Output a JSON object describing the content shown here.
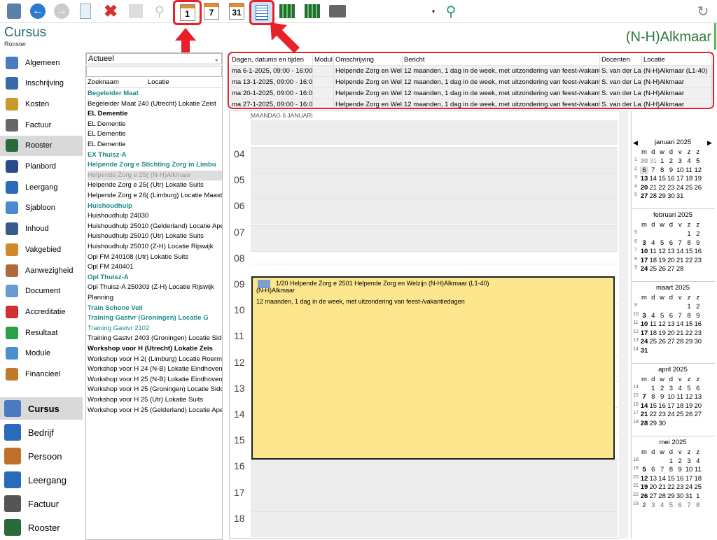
{
  "header": {
    "title": "Cursus",
    "subtitle": "Rooster",
    "right": "(N-H)Alkmaar"
  },
  "toolbar": {
    "cal1": "1",
    "cal7": "7",
    "cal31": "31"
  },
  "sidebar": {
    "items": [
      "Algemeen",
      "Inschrijving",
      "Kosten",
      "Factuur",
      "Rooster",
      "Planbord",
      "Leergang",
      "Sjabloon",
      "Inhoud",
      "Vakgebied",
      "Aanwezigheid",
      "Document",
      "Accreditatie",
      "Resultaat",
      "Module",
      "Financieel"
    ],
    "bottom": [
      "Cursus",
      "Bedrijf",
      "Persoon",
      "Leergang",
      "Factuur",
      "Rooster"
    ]
  },
  "list": {
    "dropdown": "Actueel",
    "col_name": "Zoeknaam",
    "col_loc": "Locatie",
    "items": [
      {
        "t": "Begeleider Maat",
        "c": "grp"
      },
      {
        "t": "Begeleider Maat 240 (Utrecht) Lokatie Zeist",
        "c": ""
      },
      {
        "t": "EL Dementie",
        "c": "bold"
      },
      {
        "t": "EL Dementie",
        "c": ""
      },
      {
        "t": "EL Dementie",
        "c": ""
      },
      {
        "t": "EL Dementie",
        "c": ""
      },
      {
        "t": "EX Thuisz-A",
        "c": "grp"
      },
      {
        "t": "Helpende Zorg e   Stichting Zorg in Limbu",
        "c": "grp"
      },
      {
        "t": "Helpende Zorg e 25( (N-H)Alkmaar",
        "c": "gray"
      },
      {
        "t": "Helpende Zorg e 25( (Utr) Lokatie Suits",
        "c": ""
      },
      {
        "t": "Helpende Zorg e 26( (Limburg) Locatie Maastric",
        "c": ""
      },
      {
        "t": "Huishoudhulp",
        "c": "grp"
      },
      {
        "t": "Huishoudhulp 24030",
        "c": ""
      },
      {
        "t": "Huishoudhulp 25010 (Gelderland) Locatie Apelc",
        "c": ""
      },
      {
        "t": "Huishoudhulp 25010 (Utr) Lokatie Suits",
        "c": ""
      },
      {
        "t": "Huishoudhulp 25010 (Z-H) Locatie Rijswijk",
        "c": ""
      },
      {
        "t": "Opl FM 240108       (Utr) Lokatie Suits",
        "c": ""
      },
      {
        "t": "Opl FM 240401",
        "c": ""
      },
      {
        "t": "Opl Thuisz-A",
        "c": "grp"
      },
      {
        "t": "Opl Thuisz-A 250303 (Z-H) Locatie Rijswijk",
        "c": ""
      },
      {
        "t": "Planning",
        "c": ""
      },
      {
        "t": "Train Schone Veil",
        "c": "grp"
      },
      {
        "t": "Training Gastvr    (Groningen) Locatie G",
        "c": "grp"
      },
      {
        "t": "Training Gastvr 2102",
        "c": "teal"
      },
      {
        "t": "Training Gastvr 2403 (Groningen) Locatie Sidde",
        "c": ""
      },
      {
        "t": "Workshop voor H  (Utrecht) Lokatie Zeis",
        "c": "bold"
      },
      {
        "t": "Workshop voor H 2( (Limburg) Locatie Roermor",
        "c": ""
      },
      {
        "t": "Workshop voor H 24 (N-B) Lokatie Eindhoven",
        "c": ""
      },
      {
        "t": "Workshop voor H 25 (N-B) Lokatie Eindhoven",
        "c": ""
      },
      {
        "t": "Workshop voor H 25 (Groningen) Locatie Sidde",
        "c": ""
      },
      {
        "t": "Workshop voor H 25 (Utr) Lokatie Suits",
        "c": ""
      },
      {
        "t": "Workshop voor H 25 (Gelderland) Locatie Apelc",
        "c": ""
      }
    ]
  },
  "table": {
    "headers": [
      "Dagen, datums en tijden",
      "Modul",
      "Omschrijving",
      "Bericht",
      "Docenten",
      "Locatie"
    ],
    "rows": [
      [
        "ma 6-1-2025, 09:00 - 16:00",
        "",
        "Helpende Zorg en Welz",
        "12 maanden, 1 dag in de week, met uitzondering van feest-/vakanti",
        "S. van der Lai",
        "(N-H)Alkmaar (L1-40)"
      ],
      [
        "ma 13-1-2025, 09:00 - 16:0",
        "",
        "Helpende Zorg en Welz",
        "12 maanden, 1 dag in de week, met uitzondering van feest-/vakanti",
        "S. van der Lai",
        "(N-H)Alkmaar"
      ],
      [
        "ma 20-1-2025, 09:00 - 16:0",
        "",
        "Helpende Zorg en Welz",
        "12 maanden, 1 dag in de week, met uitzondering van feest-/vakanti",
        "S. van der Lai",
        "(N-H)Alkmaar"
      ],
      [
        "ma 27-1-2025, 09:00 - 16:0",
        "",
        "Helpende Zorg en Welz",
        "12 maanden, 1 dag in de week, met uitzondering van feest-/vakanti",
        "S. van der Lai",
        "(N-H)Alkmaar"
      ]
    ]
  },
  "schedule": {
    "day": "MAANDAG 6 JANUARI",
    "hours": [
      "04",
      "05",
      "06",
      "07",
      "08",
      "09",
      "10",
      "11",
      "12",
      "13",
      "14",
      "15",
      "16",
      "17",
      "18"
    ],
    "event_line1": "1/20 Helpende Zorg e 2501 Helpende Zorg en Welzijn (N-H)Alkmaar (L1-40)",
    "event_line2": "(N-H)Alkmaar",
    "event_line3": "12 maanden, 1 dag in de week, met uitzondering van feest-/vakantiedagen"
  },
  "months": [
    {
      "title": "januari 2025",
      "dow": [
        "m",
        "d",
        "w",
        "d",
        "v",
        "z",
        "z"
      ],
      "weeks": [
        [
          "1",
          "30",
          "31",
          "1",
          "2",
          "3",
          "4",
          "5"
        ],
        [
          "2",
          "6",
          "7",
          "8",
          "9",
          "10",
          "11",
          "12"
        ],
        [
          "3",
          "13",
          "14",
          "15",
          "16",
          "17",
          "18",
          "19"
        ],
        [
          "4",
          "20",
          "21",
          "22",
          "23",
          "24",
          "25",
          "26"
        ],
        [
          "5",
          "27",
          "28",
          "29",
          "30",
          "31",
          "",
          ""
        ]
      ]
    },
    {
      "title": "februari 2025",
      "dow": [
        "m",
        "d",
        "w",
        "d",
        "v",
        "z",
        "z"
      ],
      "weeks": [
        [
          "5",
          "",
          "",
          "",
          "",
          "",
          "1",
          "2"
        ],
        [
          "6",
          "3",
          "4",
          "5",
          "6",
          "7",
          "8",
          "9"
        ],
        [
          "7",
          "10",
          "11",
          "12",
          "13",
          "14",
          "15",
          "16"
        ],
        [
          "8",
          "17",
          "18",
          "19",
          "20",
          "21",
          "22",
          "23"
        ],
        [
          "9",
          "24",
          "25",
          "26",
          "27",
          "28",
          "",
          ""
        ]
      ]
    },
    {
      "title": "maart 2025",
      "dow": [
        "m",
        "d",
        "w",
        "d",
        "v",
        "z",
        "z"
      ],
      "weeks": [
        [
          "9",
          "",
          "",
          "",
          "",
          "",
          "1",
          "2"
        ],
        [
          "10",
          "3",
          "4",
          "5",
          "6",
          "7",
          "8",
          "9"
        ],
        [
          "11",
          "10",
          "11",
          "12",
          "13",
          "14",
          "15",
          "16"
        ],
        [
          "12",
          "17",
          "18",
          "19",
          "20",
          "21",
          "22",
          "23"
        ],
        [
          "13",
          "24",
          "25",
          "26",
          "27",
          "28",
          "29",
          "30"
        ],
        [
          "14",
          "31",
          "",
          "",
          "",
          "",
          "",
          ""
        ]
      ]
    },
    {
      "title": "april 2025",
      "dow": [
        "m",
        "d",
        "w",
        "d",
        "v",
        "z",
        "z"
      ],
      "weeks": [
        [
          "14",
          "",
          "1",
          "2",
          "3",
          "4",
          "5",
          "6"
        ],
        [
          "15",
          "7",
          "8",
          "9",
          "10",
          "11",
          "12",
          "13"
        ],
        [
          "16",
          "14",
          "15",
          "16",
          "17",
          "18",
          "19",
          "20"
        ],
        [
          "17",
          "21",
          "22",
          "23",
          "24",
          "25",
          "26",
          "27"
        ],
        [
          "18",
          "28",
          "29",
          "30",
          "",
          "",
          "",
          ""
        ]
      ]
    },
    {
      "title": "mei 2025",
      "dow": [
        "m",
        "d",
        "w",
        "d",
        "v",
        "z",
        "z"
      ],
      "weeks": [
        [
          "18",
          "",
          "",
          "",
          "1",
          "2",
          "3",
          "4"
        ],
        [
          "19",
          "5",
          "6",
          "7",
          "8",
          "9",
          "10",
          "11"
        ],
        [
          "20",
          "12",
          "13",
          "14",
          "15",
          "16",
          "17",
          "18"
        ],
        [
          "21",
          "19",
          "20",
          "21",
          "22",
          "23",
          "24",
          "25"
        ],
        [
          "22",
          "26",
          "27",
          "28",
          "29",
          "30",
          "31",
          "1"
        ],
        [
          "23",
          "2",
          "3",
          "4",
          "5",
          "6",
          "7",
          "8"
        ]
      ]
    }
  ],
  "colors": {
    "accent": "#e8202a",
    "event": "#fbe58d",
    "teal": "#1a8a8a"
  }
}
